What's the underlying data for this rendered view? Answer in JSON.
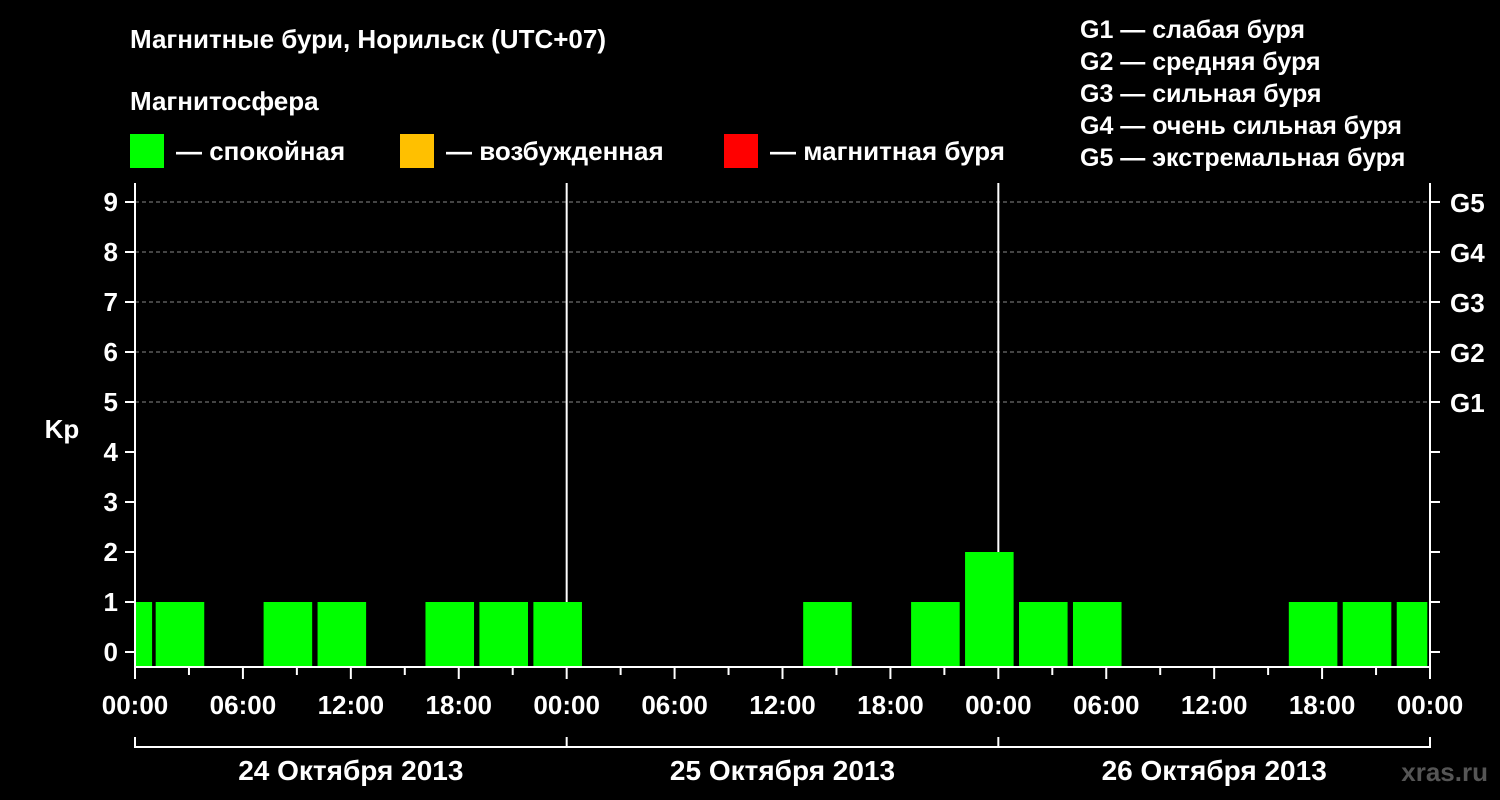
{
  "title": "Магнитные бури, Норильск (UTC+07)",
  "subtitle": "Магнитосфера",
  "legend": [
    {
      "label": "— спокойная",
      "color": "#00ff00"
    },
    {
      "label": "— возбужденная",
      "color": "#ffc000"
    },
    {
      "label": "— магнитная буря",
      "color": "#ff0000"
    }
  ],
  "g_legend": [
    "G1 — слабая буря",
    "G2 — средняя буря",
    "G3 — сильная буря",
    "G4 — очень сильная буря",
    "G5 — экстремальная буря"
  ],
  "watermark": "xras.ru",
  "chart_data": {
    "type": "bar",
    "ylabel": "Kp",
    "ylim": [
      0,
      9
    ],
    "yticks": [
      0,
      1,
      2,
      3,
      4,
      5,
      6,
      7,
      8,
      9
    ],
    "right_ticks": [
      {
        "value": 5,
        "label": "G1"
      },
      {
        "value": 6,
        "label": "G2"
      },
      {
        "value": 7,
        "label": "G3"
      },
      {
        "value": 8,
        "label": "G4"
      },
      {
        "value": 9,
        "label": "G5"
      }
    ],
    "xlim_hours": [
      0,
      72
    ],
    "x_tick_labels": [
      "00:00",
      "06:00",
      "12:00",
      "18:00",
      "00:00",
      "06:00",
      "12:00",
      "18:00",
      "00:00",
      "06:00",
      "12:00",
      "18:00",
      "00:00"
    ],
    "days": [
      "24 Октября 2013",
      "25 Октября 2013",
      "26 Октября 2013"
    ],
    "bar_color": "#00ff00",
    "bars": [
      {
        "start_hour": 0,
        "end_hour": 0.95,
        "kp": 1
      },
      {
        "start_hour": 1.15,
        "end_hour": 3.85,
        "kp": 1
      },
      {
        "start_hour": 7.15,
        "end_hour": 9.85,
        "kp": 1
      },
      {
        "start_hour": 10.15,
        "end_hour": 12.85,
        "kp": 1
      },
      {
        "start_hour": 16.15,
        "end_hour": 18.85,
        "kp": 1
      },
      {
        "start_hour": 19.15,
        "end_hour": 21.85,
        "kp": 1
      },
      {
        "start_hour": 22.15,
        "end_hour": 24.85,
        "kp": 1
      },
      {
        "start_hour": 37.15,
        "end_hour": 39.85,
        "kp": 1
      },
      {
        "start_hour": 43.15,
        "end_hour": 45.85,
        "kp": 1
      },
      {
        "start_hour": 46.15,
        "end_hour": 48.85,
        "kp": 2
      },
      {
        "start_hour": 49.15,
        "end_hour": 51.85,
        "kp": 1
      },
      {
        "start_hour": 52.15,
        "end_hour": 54.85,
        "kp": 1
      },
      {
        "start_hour": 64.15,
        "end_hour": 66.85,
        "kp": 1
      },
      {
        "start_hour": 67.15,
        "end_hour": 69.85,
        "kp": 1
      },
      {
        "start_hour": 70.15,
        "end_hour": 71.85,
        "kp": 1
      }
    ]
  }
}
